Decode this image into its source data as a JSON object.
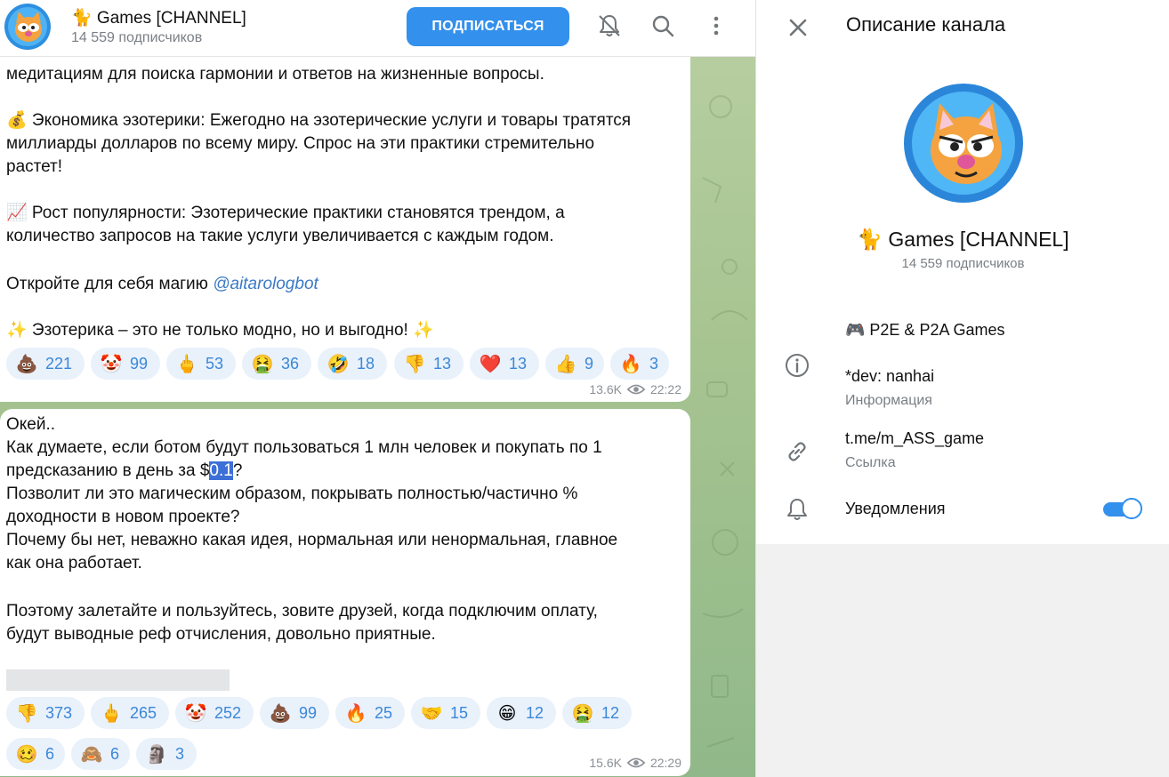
{
  "header": {
    "title": "🐈 Games [CHANNEL]",
    "subscribers": "14 559 подписчиков",
    "subscribe_label": "ПОДПИСАТЬСЯ"
  },
  "message1": {
    "lines": [
      "медитациям для поиска гармонии и ответов на жизненные вопросы.",
      "💰 Экономика эзотерики: Ежегодно на эзотерические услуги и товары тратятся",
      "миллиарды долларов по всему миру. Спрос на эти практики стремительно",
      "растет!",
      "📈 Рост популярности: Эзотерические практики становятся трендом, а",
      "количество запросов на такие услуги увеличивается с каждым годом.",
      "Откройте для себя магию ",
      "✨ Эзотерика – это не только модно, но и выгодно! ✨"
    ],
    "mention": "@aitarologbot",
    "reactions": [
      {
        "emoji": "💩",
        "count": "221"
      },
      {
        "emoji": "🤡",
        "count": "99"
      },
      {
        "emoji": "🖕",
        "count": "53"
      },
      {
        "emoji": "🤮",
        "count": "36"
      },
      {
        "emoji": "🤣",
        "count": "18"
      },
      {
        "emoji": "👎",
        "count": "13"
      },
      {
        "emoji": "❤️",
        "count": "13"
      },
      {
        "emoji": "👍",
        "count": "9"
      },
      {
        "emoji": "🔥",
        "count": "3"
      }
    ],
    "views": "13.6K",
    "time": "22:22"
  },
  "message2": {
    "lines": [
      "Окей..",
      "Как думаете, если ботом будут пользоваться 1 млн человек и покупать по 1",
      "предсказанию в день за $",
      "Позволит ли это магическим образом, покрывать полностью/частично %",
      "доходности в новом проекте?",
      "Почему бы нет, неважно какая идея, нормальная или ненормальная, главное",
      "как она работает.",
      "Поэтому залетайте и пользуйтесь, зовите друзей, когда подключим оплату,",
      "будут выводные реф отчисления, довольно приятные."
    ],
    "highlight": "0.1",
    "after_highlight": "?",
    "reactions_row1": [
      {
        "emoji": "👎",
        "count": "373"
      },
      {
        "emoji": "🖕",
        "count": "265"
      },
      {
        "emoji": "🤡",
        "count": "252"
      },
      {
        "emoji": "💩",
        "count": "99"
      },
      {
        "emoji": "🔥",
        "count": "25"
      },
      {
        "emoji": "🤝",
        "count": "15"
      },
      {
        "emoji": "😁",
        "count": "12"
      },
      {
        "emoji": "🤮",
        "count": "12"
      }
    ],
    "reactions_row2": [
      {
        "emoji": "🥴",
        "count": "6"
      },
      {
        "emoji": "🙈",
        "count": "6"
      },
      {
        "emoji": "🗿",
        "count": "3"
      }
    ],
    "views": "15.6K",
    "time": "22:29"
  },
  "panel": {
    "title": "Описание канала",
    "name": "🐈 Games [CHANNEL]",
    "subscribers": "14 559 подписчиков",
    "description_line1": "🎮 P2E & P2A Games",
    "description_line2": "*dev: nanhai",
    "info_label": "Информация",
    "link": "t.me/m_ASS_game",
    "link_label": "Ссылка",
    "notifications_label": "Уведомления",
    "notifications_on": true
  },
  "colors": {
    "accent": "#3390ec",
    "reaction_bg": "#e9f1fb",
    "reaction_text": "#3a87d8",
    "chat_bg": "#a6c490"
  }
}
